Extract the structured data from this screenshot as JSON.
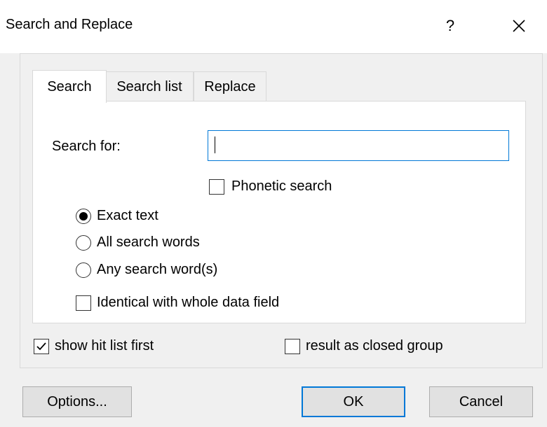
{
  "window": {
    "title": "Search and Replace",
    "help_label": "?"
  },
  "tabs": [
    {
      "label": "Search",
      "active": true
    },
    {
      "label": "Search list",
      "active": false
    },
    {
      "label": "Replace",
      "active": false
    }
  ],
  "search": {
    "label": "Search for:",
    "value": "",
    "phonetic": {
      "label": "Phonetic search",
      "checked": false
    }
  },
  "match_mode": {
    "options": [
      {
        "label": "Exact text",
        "selected": true
      },
      {
        "label": "All search words",
        "selected": false
      },
      {
        "label": "Any search word(s)",
        "selected": false
      }
    ]
  },
  "identical": {
    "label": "Identical with whole data field",
    "checked": false
  },
  "bottom_options": {
    "show_hit_list": {
      "label": "show hit list first",
      "checked": true
    },
    "closed_group": {
      "label": "result as closed group",
      "checked": false
    }
  },
  "buttons": {
    "options": "Options...",
    "ok": "OK",
    "cancel": "Cancel"
  },
  "colors": {
    "accent": "#0078d7",
    "dialog_bg": "#f0f0f0",
    "button_bg": "#e1e1e1"
  }
}
